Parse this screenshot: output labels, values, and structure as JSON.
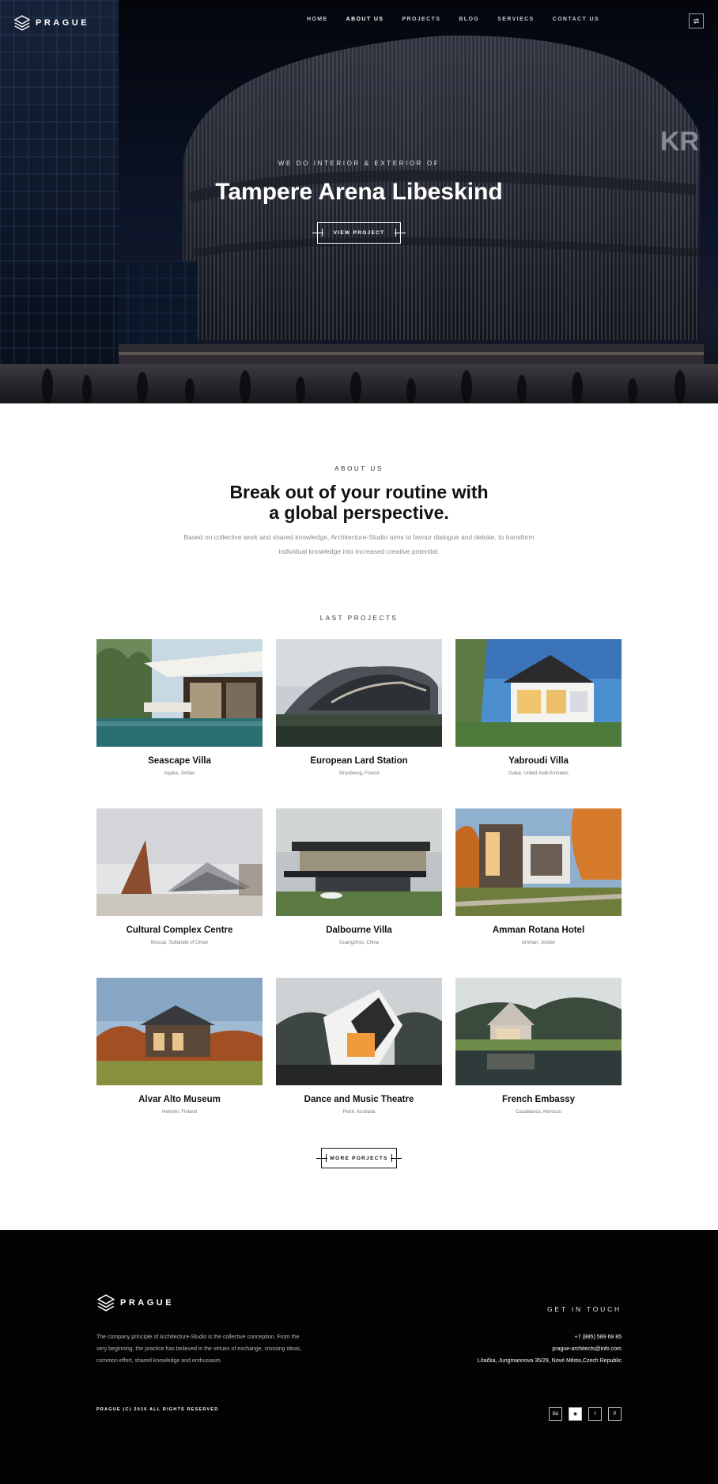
{
  "brand": {
    "name": "PRAGUE"
  },
  "nav": {
    "items": [
      {
        "label": "HOME",
        "active": false
      },
      {
        "label": "ABOUT US",
        "active": true
      },
      {
        "label": "PROJECTS",
        "active": false
      },
      {
        "label": "BLOG",
        "active": false
      },
      {
        "label": "SERVIECS",
        "active": false
      },
      {
        "label": "CONTACT US",
        "active": false
      }
    ],
    "menu_icon": "swap-icon"
  },
  "hero": {
    "subtitle": "WE DO INTERIOR & EXTERIOR OF",
    "title": "Tampere Arena Libeskind",
    "button_label": "VIEW PROJECT"
  },
  "about": {
    "label": "ABOUT US",
    "title_line1": "Break out of your routine with",
    "title_line2": "a global perspective.",
    "text": "Based on collective work and shared knowledge, Architecture-Studio aims to favour dialogue and debate, to transform individual knowledge into increased creative potential."
  },
  "projects": {
    "label": "LAST PROJECTS",
    "items": [
      {
        "name": "Seascape Villa",
        "location": "Aqaba, Jordan"
      },
      {
        "name": "European Lard Station",
        "location": "Strasbourg, France"
      },
      {
        "name": "Yabroudi Villa",
        "location": "Dubai, United Arab Emirates"
      },
      {
        "name": "Cultural Complex Centre",
        "location": "Muscat, Sultanate of Oman"
      },
      {
        "name": "Dalbourne Villa",
        "location": "Guangzhou, China"
      },
      {
        "name": "Amman Rotana Hotel",
        "location": "Amman, Jordan"
      },
      {
        "name": "Alvar Alto Museum",
        "location": "Helsinki, Finland"
      },
      {
        "name": "Dance and Music Theatre",
        "location": "Perth, Australia"
      },
      {
        "name": "French Embassy",
        "location": "Casablanca, Morocco"
      }
    ],
    "more_label": "MORE PORJECTS"
  },
  "footer": {
    "about_text": "The company principle of Architecture-Studio is the collective conception. From the very beginning, the practice has believed in the virtues of exchange, crossing ideas, common effort, shared knowledge and enthusiasm.",
    "get_in_touch": "GET IN TOUCH",
    "phone": "+7 (885) 589 69 85",
    "email": "prague-architects@info.com",
    "address": "Lítačka, Jungmannova 35/29, Nové Město,Czech Republic",
    "copyright": "PRAGUE (C) 2016 ALL RIGHTS RESERVED",
    "socials": [
      {
        "name": "behance-icon",
        "glyph": "Bē"
      },
      {
        "name": "dribbble-icon",
        "glyph": "◉"
      },
      {
        "name": "facebook-icon",
        "glyph": "f"
      },
      {
        "name": "pinterest-icon",
        "glyph": "P"
      }
    ]
  }
}
